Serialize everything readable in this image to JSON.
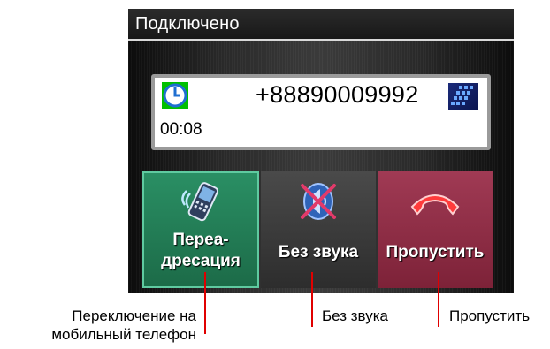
{
  "status_title": "Подключено",
  "call": {
    "phone_number": "+88890009992",
    "duration": "00:08",
    "icons": {
      "timer": "clock-icon",
      "keypad": "keypad-icon"
    }
  },
  "buttons": {
    "forward": {
      "label_line1": "Переа-",
      "label_line2": "дресация",
      "icon": "mobile-phone-icon",
      "color": "#1c6b48"
    },
    "mute": {
      "label": "Без звука",
      "icon": "speaker-muted-icon",
      "color": "#3a3a3a"
    },
    "reject": {
      "label": "Пропустить",
      "icon": "hang-up-icon",
      "color": "#8a2a44"
    }
  },
  "callouts": {
    "forward_line1": "Переключение на",
    "forward_line2": "мобильный телефон",
    "mute": "Без звука",
    "reject": "Пропустить"
  },
  "accent_colors": {
    "callout_line": "#e00000"
  }
}
